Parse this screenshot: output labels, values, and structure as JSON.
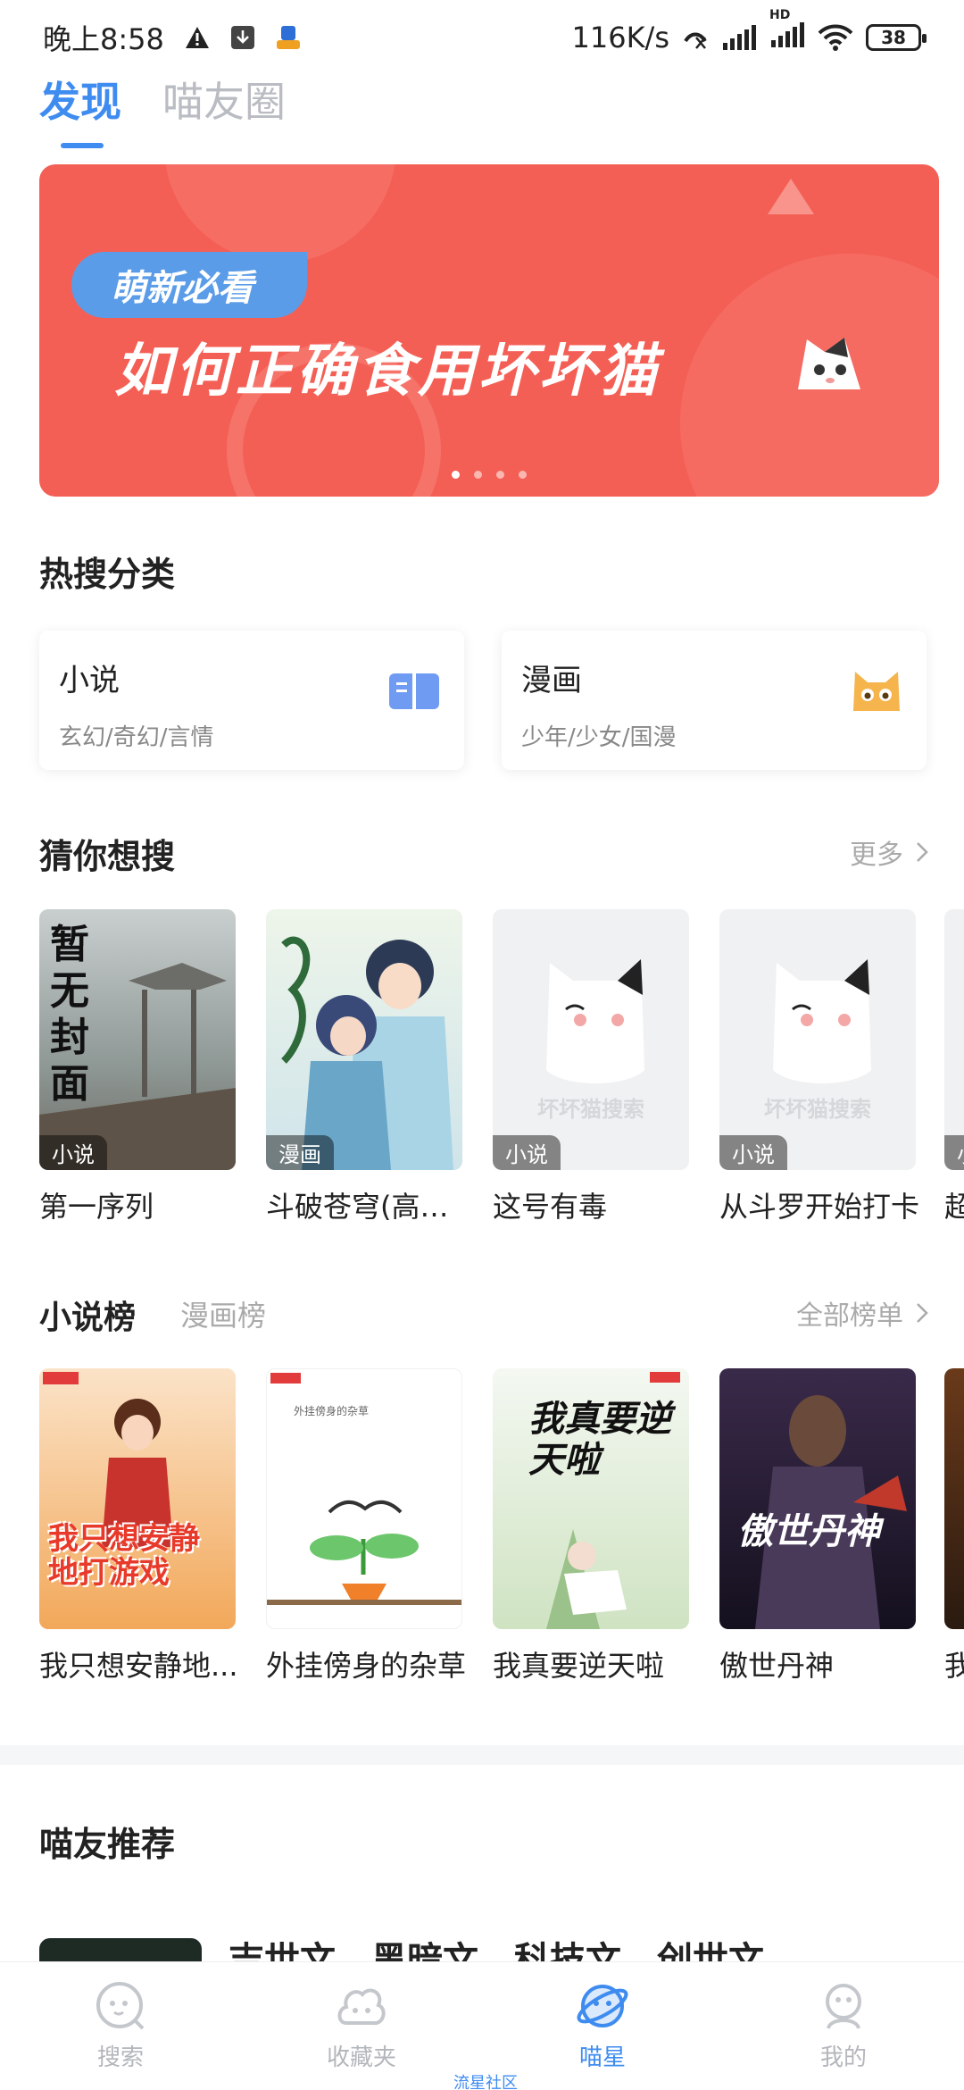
{
  "status_bar": {
    "time": "晚上8:58",
    "net_speed": "116K/s",
    "battery": "38",
    "hd": "HD"
  },
  "top_tabs": [
    {
      "label": "发现",
      "active": true
    },
    {
      "label": "喵友圈",
      "active": false
    }
  ],
  "banner": {
    "tag": "萌新必看",
    "title": "如何正确食用坏坏猫",
    "page_count": 4,
    "current_page": 1
  },
  "hot_categories": {
    "title": "热搜分类",
    "items": [
      {
        "name": "小说",
        "sub": "玄幻/奇幻/言情",
        "icon": "book-icon"
      },
      {
        "name": "漫画",
        "sub": "少年/少女/国漫",
        "icon": "cat-face-icon"
      }
    ]
  },
  "guess": {
    "title": "猜你想搜",
    "more": "更多",
    "books": [
      {
        "title": "第一序列",
        "badge": "小说",
        "cover_text": "暂无封面"
      },
      {
        "title": "斗破苍穹(高清...",
        "badge": "漫画",
        "cover_text": ""
      },
      {
        "title": "这号有毒",
        "badge": "小说",
        "cover_text": "坏坏猫搜索"
      },
      {
        "title": "从斗罗开始打卡",
        "badge": "小说",
        "cover_text": "坏坏猫搜索"
      },
      {
        "title": "超",
        "badge": "小",
        "cover_text": ""
      }
    ]
  },
  "rankings": {
    "tabs": [
      {
        "label": "小说榜",
        "active": true
      },
      {
        "label": "漫画榜",
        "active": false
      }
    ],
    "more": "全部榜单",
    "books": [
      {
        "title": "我只想安静地...",
        "cover_text": "我只想安静地打游戏"
      },
      {
        "title": "外挂傍身的杂草",
        "cover_text": "外挂傍身的杂草"
      },
      {
        "title": "我真要逆天啦",
        "cover_text": "我真要逆天啦"
      },
      {
        "title": "傲世丹神",
        "cover_text": "傲世丹神"
      },
      {
        "title": "我",
        "cover_text": ""
      }
    ]
  },
  "pal_recommend": {
    "title": "喵友推荐",
    "tags": [
      "吉世文",
      "黑暗文",
      "科技文",
      "创世文"
    ]
  },
  "bottom_nav": {
    "items": [
      {
        "label": "搜索",
        "icon": "search-face-icon",
        "active": false
      },
      {
        "label": "收藏夹",
        "icon": "favorites-icon",
        "active": false
      },
      {
        "label": "喵星",
        "icon": "planet-icon",
        "active": true
      },
      {
        "label": "我的",
        "icon": "profile-icon",
        "active": false
      }
    ],
    "sub_label": "流星社区"
  },
  "colors": {
    "accent": "#3f8cf0",
    "banner_bg": "#f45f55",
    "banner_tag": "#5a9ce8"
  }
}
